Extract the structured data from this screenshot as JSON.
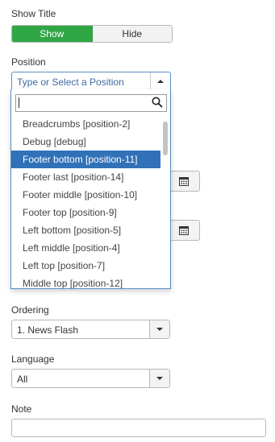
{
  "show_title": {
    "label": "Show Title",
    "options": [
      "Show",
      "Hide"
    ],
    "selected": "Show",
    "accent_color": "#2fa745"
  },
  "position": {
    "label": "Position",
    "placeholder": "Type or Select a Position",
    "search_value": "",
    "items": [
      "Breadcrumbs [position-2]",
      "Debug [debug]",
      "Footer bottom [position-11]",
      "Footer last [position-14]",
      "Footer middle [position-10]",
      "Footer top [position-9]",
      "Left bottom [position-5]",
      "Left middle [position-4]",
      "Left top [position-7]",
      "Middle top [position-12]"
    ],
    "highlighted": "Footer bottom [position-11]",
    "highlight_color": "#3071b8"
  },
  "ordering": {
    "label": "Ordering",
    "value": "1. News Flash"
  },
  "language": {
    "label": "Language",
    "value": "All"
  },
  "note": {
    "label": "Note",
    "value": ""
  }
}
